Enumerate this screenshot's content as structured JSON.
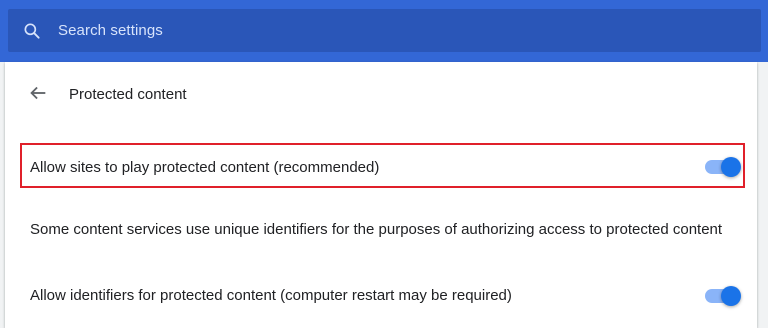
{
  "search": {
    "placeholder": "Search settings"
  },
  "header": {
    "back_icon": "back-arrow-icon",
    "title": "Protected content"
  },
  "settings": {
    "allow_protected": {
      "label": "Allow sites to play protected content (recommended)",
      "enabled": true,
      "highlighted": true
    },
    "description": "Some content services use unique identifiers for the purposes of authorizing access to protected content",
    "allow_identifiers": {
      "label": "Allow identifiers for protected content (computer restart may be required)",
      "enabled": true
    }
  },
  "colors": {
    "top_bar": "#3367d6",
    "search_box": "#2a56b8",
    "toggle_on_knob": "#1a73e8",
    "toggle_on_track": "#8ab4f8",
    "highlight_border": "#e0202a"
  }
}
